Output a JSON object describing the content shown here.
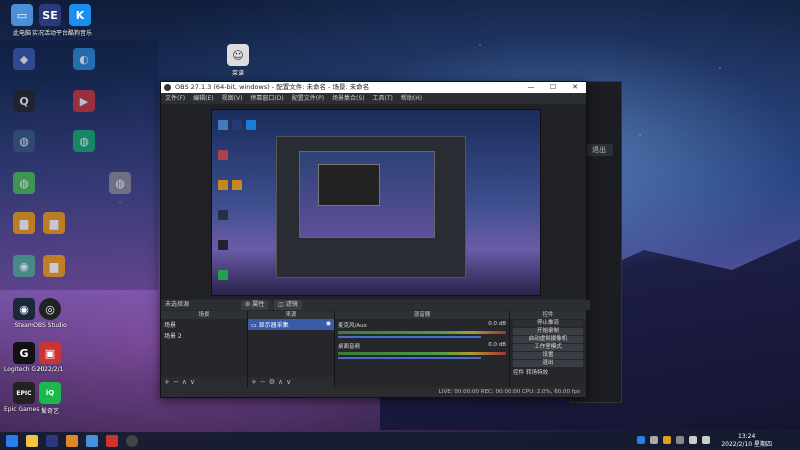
{
  "desktop": {
    "icons": [
      {
        "label": "此电脑",
        "color": "#4a8fd8",
        "glyph": "▭"
      },
      {
        "label": "实况活动平台",
        "color": "#2b3a7a",
        "glyph": "SE"
      },
      {
        "label": "酷狗音乐",
        "color": "#1c8ef0",
        "glyph": "K"
      },
      {
        "label": "Steam",
        "color": "#1b2838",
        "glyph": "◉"
      },
      {
        "label": "OBS Studio",
        "color": "#222",
        "glyph": "◎"
      },
      {
        "label": "Logitech G HUB",
        "color": "#111",
        "glyph": "G"
      },
      {
        "label": "2022/2/1",
        "color": "#c33",
        "glyph": "▣"
      },
      {
        "label": "Epic Games Launcher",
        "color": "#222",
        "glyph": "EPIC"
      },
      {
        "label": "爱奇艺",
        "color": "#1bb94a",
        "glyph": "iQ"
      },
      {
        "label": "菜谱",
        "color": "#ddd",
        "glyph": "☺"
      }
    ],
    "ghost_labels": [
      "远程桌面",
      "设备号",
      "全屏显示"
    ]
  },
  "bg_app": {
    "out_button": "退出"
  },
  "obs": {
    "title": "OBS 27.1.3 (64-bit, windows) - 配置文件: 未命名 - 场景: 未命名",
    "menu": [
      "文件(F)",
      "编辑(E)",
      "视图(V)",
      "停靠窗口(D)",
      "配置文件(P)",
      "场景集合(S)",
      "工具(T)",
      "帮助(H)"
    ],
    "scene_bar": {
      "label": "未选择源",
      "properties": "属性",
      "filters": "滤镜"
    },
    "docks": {
      "scenes": {
        "header": "场景",
        "items": [
          "场景",
          "场景 2"
        ]
      },
      "sources": {
        "header": "来源",
        "items": [
          "显示器采集"
        ]
      },
      "mixer": {
        "header": "混音器",
        "channels": [
          {
            "name": "麦克风/Aux",
            "db": "0.0 dB"
          },
          {
            "name": "桌面音频",
            "db": "0.0 dB"
          }
        ]
      },
      "controls": {
        "header": "控件",
        "buttons": [
          "停止推流",
          "开始录制",
          "启动虚拟摄像机",
          "工作室模式",
          "设置",
          "退出"
        ],
        "tabs": [
          "控件",
          "转场特效"
        ]
      }
    },
    "status": "LIVE: 00:00:00   REC: 00:00:00   CPU: 2.0%, 60.00 fps"
  },
  "taskbar": {
    "time": "13:24",
    "date": "2022/2/10 星期四"
  }
}
